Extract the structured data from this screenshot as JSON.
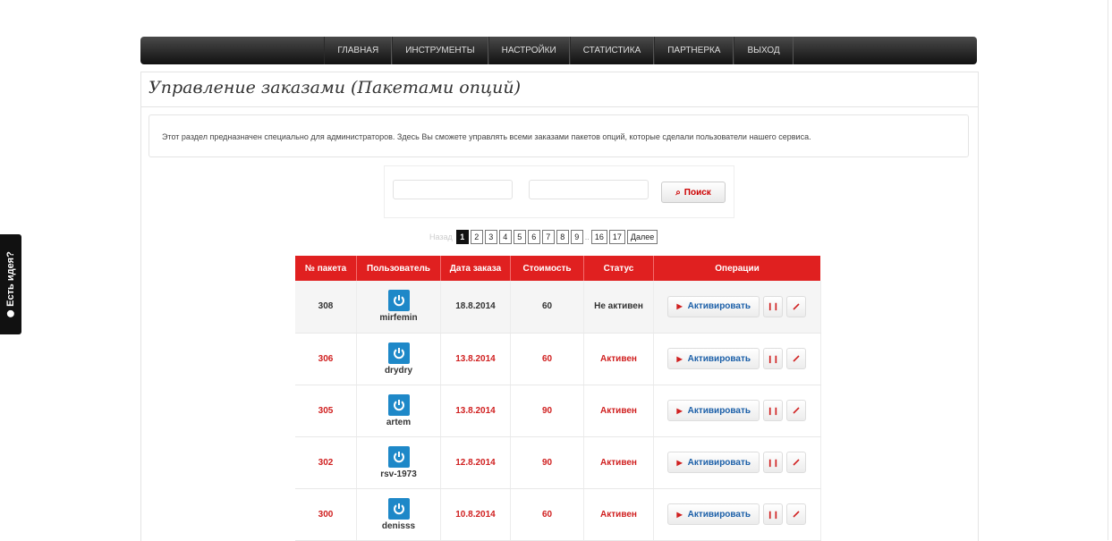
{
  "idea_tab": {
    "label": "Есть идея?"
  },
  "nav": {
    "items": [
      "ГЛАВНАЯ",
      "ИНСТРУМЕНТЫ",
      "НАСТРОЙКИ",
      "СТАТИСТИКА",
      "ПАРТНЕРКА",
      "ВЫХОД"
    ]
  },
  "page": {
    "title": "Управление заказами (Пакетами опций)",
    "description": "Этот раздел предназначен специально для администраторов. Здесь Вы сможете управлять всеми заказами пакетов опций, которые сделали пользователи нашего сервиса."
  },
  "search": {
    "field1": "",
    "field2": "",
    "button": "Поиск"
  },
  "pagination": {
    "prev": "Назад",
    "pages": [
      "1",
      "2",
      "3",
      "4",
      "5",
      "6",
      "7",
      "8",
      "9",
      "16",
      "17"
    ],
    "ellipsis": "..",
    "active": "1",
    "next": "Далее"
  },
  "table": {
    "headers": [
      "№ пакета",
      "Пользователь",
      "Дата заказа",
      "Стоимость",
      "Статус",
      "Операции"
    ],
    "rows": [
      {
        "id": "308",
        "user": "mirfemin",
        "date": "18.8.2014",
        "cost": "60",
        "status": "Не активен"
      },
      {
        "id": "306",
        "user": "drydry",
        "date": "13.8.2014",
        "cost": "60",
        "status": "Активен"
      },
      {
        "id": "305",
        "user": "artem",
        "date": "13.8.2014",
        "cost": "90",
        "status": "Активен"
      },
      {
        "id": "302",
        "user": "rsv-1973",
        "date": "12.8.2014",
        "cost": "90",
        "status": "Активен"
      },
      {
        "id": "300",
        "user": "denisss",
        "date": "10.8.2014",
        "cost": "60",
        "status": "Активен"
      }
    ],
    "activate_label": "Активировать"
  },
  "colors": {
    "accent_red": "#e02020",
    "user_icon_blue": "#1e88c8",
    "nav_dark": "#222222"
  }
}
